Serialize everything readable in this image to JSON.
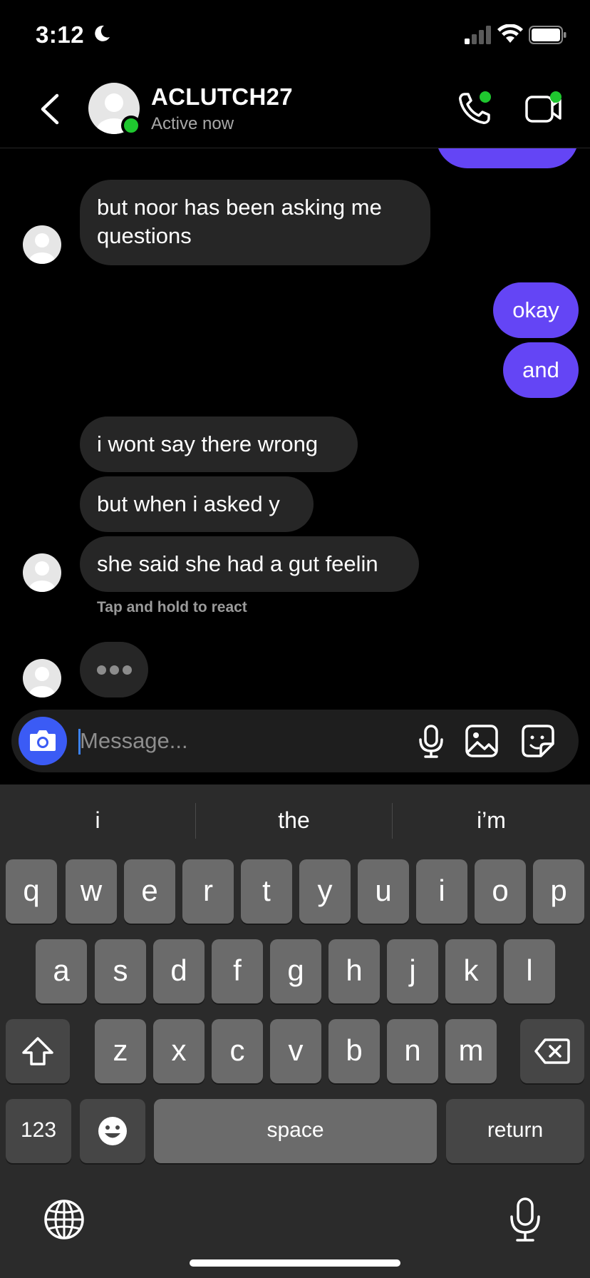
{
  "status_bar": {
    "time": "3:12"
  },
  "header": {
    "contact_name": "ACLUTCH27",
    "status": "Active now"
  },
  "messages": [
    {
      "sender": "them",
      "text": "but noor has been asking me questions"
    },
    {
      "sender": "me",
      "text": "okay"
    },
    {
      "sender": "me",
      "text": "and"
    },
    {
      "sender": "them",
      "text": "i wont say there wrong"
    },
    {
      "sender": "them",
      "text": "but when i asked y"
    },
    {
      "sender": "them",
      "text": "she said she had a gut feelin"
    }
  ],
  "react_hint": "Tap and hold to react",
  "composer": {
    "placeholder": "Message..."
  },
  "keyboard": {
    "suggestions": [
      "i",
      "the",
      "i’m"
    ],
    "row1": [
      "q",
      "w",
      "e",
      "r",
      "t",
      "y",
      "u",
      "i",
      "o",
      "p"
    ],
    "row2": [
      "a",
      "s",
      "d",
      "f",
      "g",
      "h",
      "j",
      "k",
      "l"
    ],
    "row3": [
      "z",
      "x",
      "c",
      "v",
      "b",
      "n",
      "m"
    ],
    "numbers_key": "123",
    "space_key": "space",
    "return_key": "return"
  },
  "colors": {
    "outgoing_bubble": "#6445f5",
    "incoming_bubble": "#262626",
    "online": "#1fc72f",
    "camera_button": "#3b5bf5"
  },
  "icons": [
    "moon-icon",
    "signal-icon",
    "wifi-icon",
    "battery-icon",
    "back-icon",
    "phone-icon",
    "video-icon",
    "camera-icon",
    "microphone-icon",
    "gallery-icon",
    "sticker-icon",
    "shift-icon",
    "delete-icon",
    "emoji-icon",
    "globe-icon",
    "dictation-icon"
  ]
}
